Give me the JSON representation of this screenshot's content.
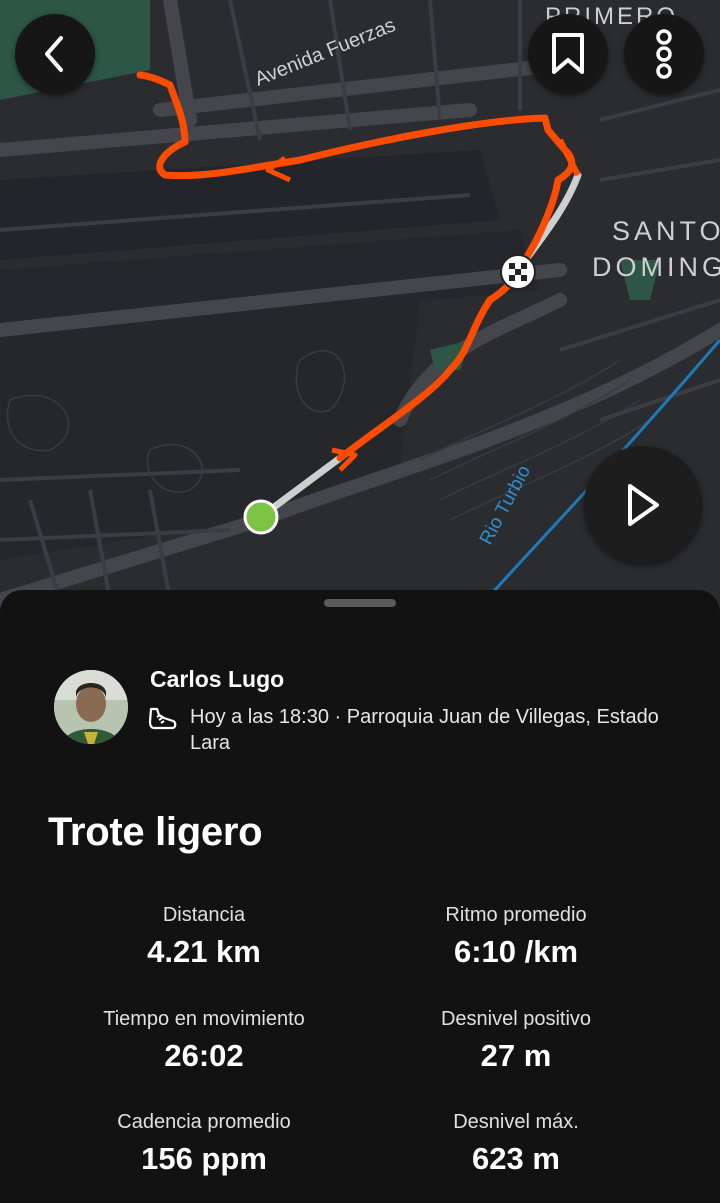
{
  "map": {
    "labels": {
      "avenue": "Avenida Fuerzas",
      "district_top": "PRIMERO",
      "district_right_1": "SANTO",
      "district_right_2": "DOMING",
      "river": "Rio Turbio"
    }
  },
  "buttons": {
    "back_icon": "chevron-left-icon",
    "bookmark_icon": "bookmark-icon",
    "more_icon": "more-vertical-icon",
    "play_icon": "play-icon"
  },
  "colors": {
    "route": "#fc4c02",
    "start": "#7cc243",
    "river": "#1e7ab8",
    "sheet_bg": "#121212"
  },
  "athlete": {
    "name": "Carlos Lugo",
    "meta": "Hoy a las 18:30 · Parroquia Juan de Villegas, Estado Lara",
    "activity_icon": "shoe-icon"
  },
  "activity": {
    "title": "Trote ligero",
    "stats": [
      {
        "label": "Distancia",
        "value": "4.21 km"
      },
      {
        "label": "Ritmo promedio",
        "value": "6:10 /km"
      },
      {
        "label": "Tiempo en movimiento",
        "value": "26:02"
      },
      {
        "label": "Desnivel positivo",
        "value": "27 m"
      },
      {
        "label": "Cadencia promedio",
        "value": "156 ppm"
      },
      {
        "label": "Desnivel máx.",
        "value": "623 m"
      }
    ]
  }
}
